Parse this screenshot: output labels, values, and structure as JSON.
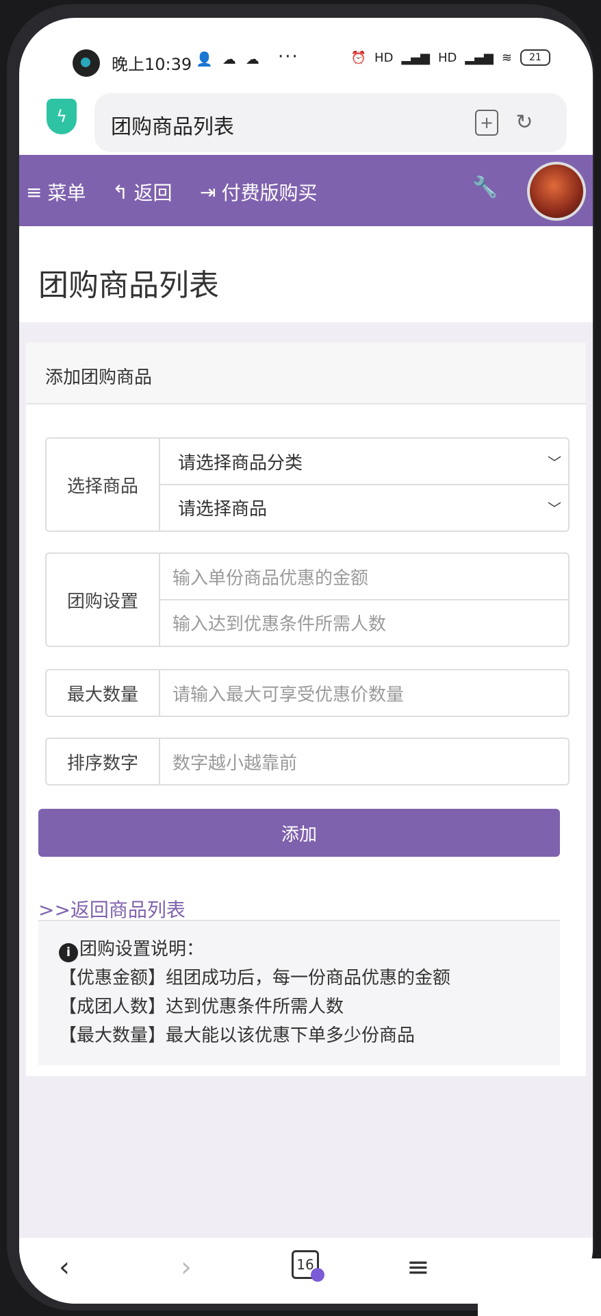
{
  "status_bar": {
    "time": "晚上10:39",
    "more": "···",
    "battery": "21",
    "network": "HD"
  },
  "browser": {
    "url_title": "团购商品列表"
  },
  "nav": {
    "menu": "菜单",
    "back": "返回",
    "buy": "付费版购买"
  },
  "page": {
    "title": "团购商品列表"
  },
  "card": {
    "title": "添加团购商品",
    "rows": {
      "select_product": {
        "label": "选择商品",
        "category_placeholder": "请选择商品分类",
        "product_placeholder": "请选择商品"
      },
      "group_settings": {
        "label": "团购设置",
        "discount_placeholder": "输入单份商品优惠的金额",
        "people_placeholder": "输入达到优惠条件所需人数"
      },
      "max_quantity": {
        "label": "最大数量",
        "placeholder": "请输入最大可享受优惠价数量"
      },
      "sort_number": {
        "label": "排序数字",
        "placeholder": "数字越小越靠前"
      }
    },
    "add_button": "添加",
    "back_link": ">>返回商品列表",
    "help": {
      "title": "团购设置说明：",
      "lines": [
        "【优惠金额】组团成功后，每一份商品优惠的金额",
        "【成团人数】达到优惠条件所需人数",
        "【最大数量】最大能以该优惠下单多少份商品"
      ]
    }
  },
  "bottom_bar": {
    "tab_count": "16"
  },
  "colors": {
    "accent": "#7f62ae",
    "page_bg": "#f0eef4"
  }
}
